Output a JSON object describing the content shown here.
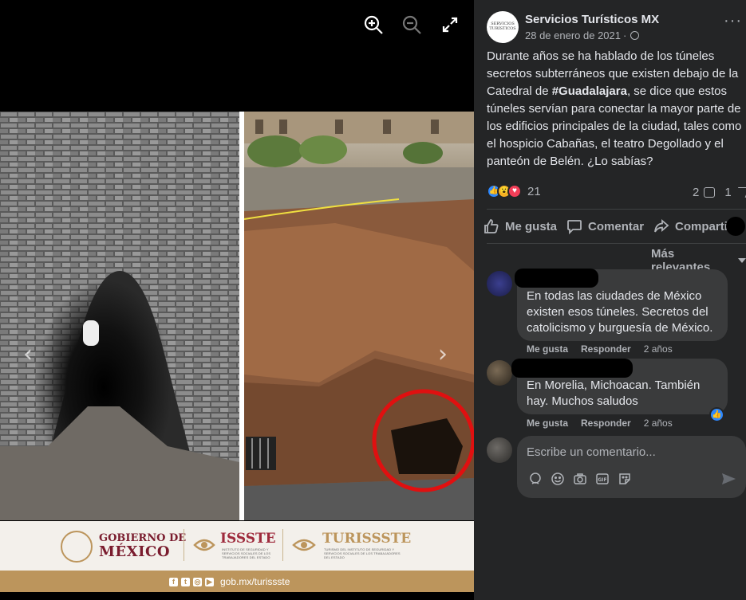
{
  "viewer": {
    "zoom_in_icon": "zoom-in-icon",
    "zoom_out_icon": "zoom-out-icon",
    "fullscreen_icon": "fullscreen-icon",
    "prev_arrow": "‹",
    "next_arrow": "›",
    "banner": {
      "gob_line1": "GOBIERNO DE",
      "gob_line2": "MÉXICO",
      "issste": "ISSSTE",
      "issste_sub": "INSTITUTO DE SEGURIDAD Y SERVICIOS SOCIALES DE LOS TRABAJADORES DEL ESTADO",
      "turissste": "TURISSSTE",
      "turissste_sub": "TURISMO DEL INSTITUTO DE SEGURIDAD Y SERVICIOS SOCIALES DE LOS TRABAJADORES DEL ESTADO",
      "url": "gob.mx/turissste"
    }
  },
  "post": {
    "page_name": "Servicios Turísticos MX",
    "avatar_text": "SERVICIOS TURÍSTICOS",
    "date": "28 de enero de 2021",
    "separator": "·",
    "more": "···",
    "text_before": "Durante años se ha hablado de los túneles secretos subterráneos que existen debajo de la Catedral de ",
    "hashtag": "#Guadalajara",
    "text_after": ", se dice que estos túneles servían para conectar la mayor parte de los edificios principales de la ciudad, tales como el hospicio Cabañas, el teatro Degollado y el panteón de Belén. ¿Lo sabías?",
    "reaction_count": "21",
    "comment_count": "2",
    "share_count": "1"
  },
  "actions": {
    "like": "Me gusta",
    "comment": "Comentar",
    "share": "Compartir"
  },
  "sort_label": "Más relevantes",
  "comments": [
    {
      "text": "En todas las ciudades de México existen esos túneles. Secretos del catolicismo y burguesía de México.",
      "like": "Me gusta",
      "reply": "Responder",
      "age": "2 años"
    },
    {
      "text": "En Morelia, Michoacan. También hay. Muchos saludos",
      "like": "Me gusta",
      "reply": "Responder",
      "age": "2 años"
    }
  ],
  "composer": {
    "placeholder": "Escribe un comentario..."
  },
  "colors": {
    "panel_bg": "#242526",
    "bubble_bg": "#3a3b3c",
    "like_blue": "#2d88ff",
    "gold": "#bc955c"
  }
}
